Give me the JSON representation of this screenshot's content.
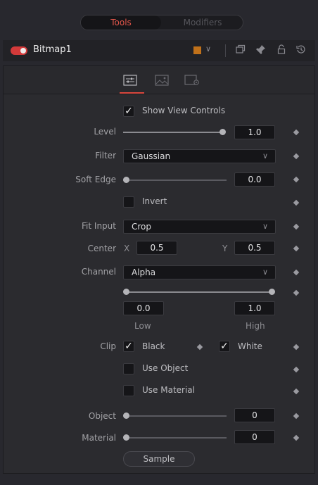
{
  "top_tabs": [
    {
      "label": "Tools",
      "active": true
    },
    {
      "label": "Modifiers",
      "active": false
    }
  ],
  "node": {
    "title": "Bitmap1",
    "color_swatch": "#c0711a",
    "enabled": true,
    "icons": [
      "color-dropdown-icon",
      "duplicate-icon",
      "pin-icon",
      "lock-icon",
      "reset-icon"
    ]
  },
  "sub_tabs": [
    {
      "icon": "controls-tab-icon",
      "active": true
    },
    {
      "icon": "image-tab-icon",
      "active": false
    },
    {
      "icon": "settings-tab-icon",
      "active": false
    }
  ],
  "controls": {
    "show_view_controls": {
      "label": "Show View Controls",
      "checked": true
    },
    "level": {
      "label": "Level",
      "value": "1.0",
      "fraction": 1.0
    },
    "filter": {
      "label": "Filter",
      "value": "Gaussian"
    },
    "soft_edge": {
      "label": "Soft Edge",
      "value": "0.0",
      "fraction": 0.0
    },
    "invert": {
      "label": "Invert",
      "checked": false
    },
    "fit_input": {
      "label": "Fit Input",
      "value": "Crop"
    },
    "center": {
      "label": "Center",
      "x_label": "X",
      "x": "0.5",
      "y_label": "Y",
      "y": "0.5"
    },
    "channel": {
      "label": "Channel",
      "value": "Alpha"
    },
    "range": {
      "low": "0.0",
      "high": "1.0",
      "low_label": "Low",
      "high_label": "High"
    },
    "clip": {
      "label": "Clip",
      "black_label": "Black",
      "black_checked": true,
      "white_label": "White",
      "white_checked": true
    },
    "use_object": {
      "label": "Use Object",
      "checked": false
    },
    "use_material": {
      "label": "Use Material",
      "checked": false
    },
    "object": {
      "label": "Object",
      "value": "0",
      "fraction": 0.0
    },
    "material": {
      "label": "Material",
      "value": "0",
      "fraction": 0.0
    },
    "sample_button": "Sample"
  },
  "colors": {
    "accent": "#e2564a",
    "background": "#28282e"
  }
}
